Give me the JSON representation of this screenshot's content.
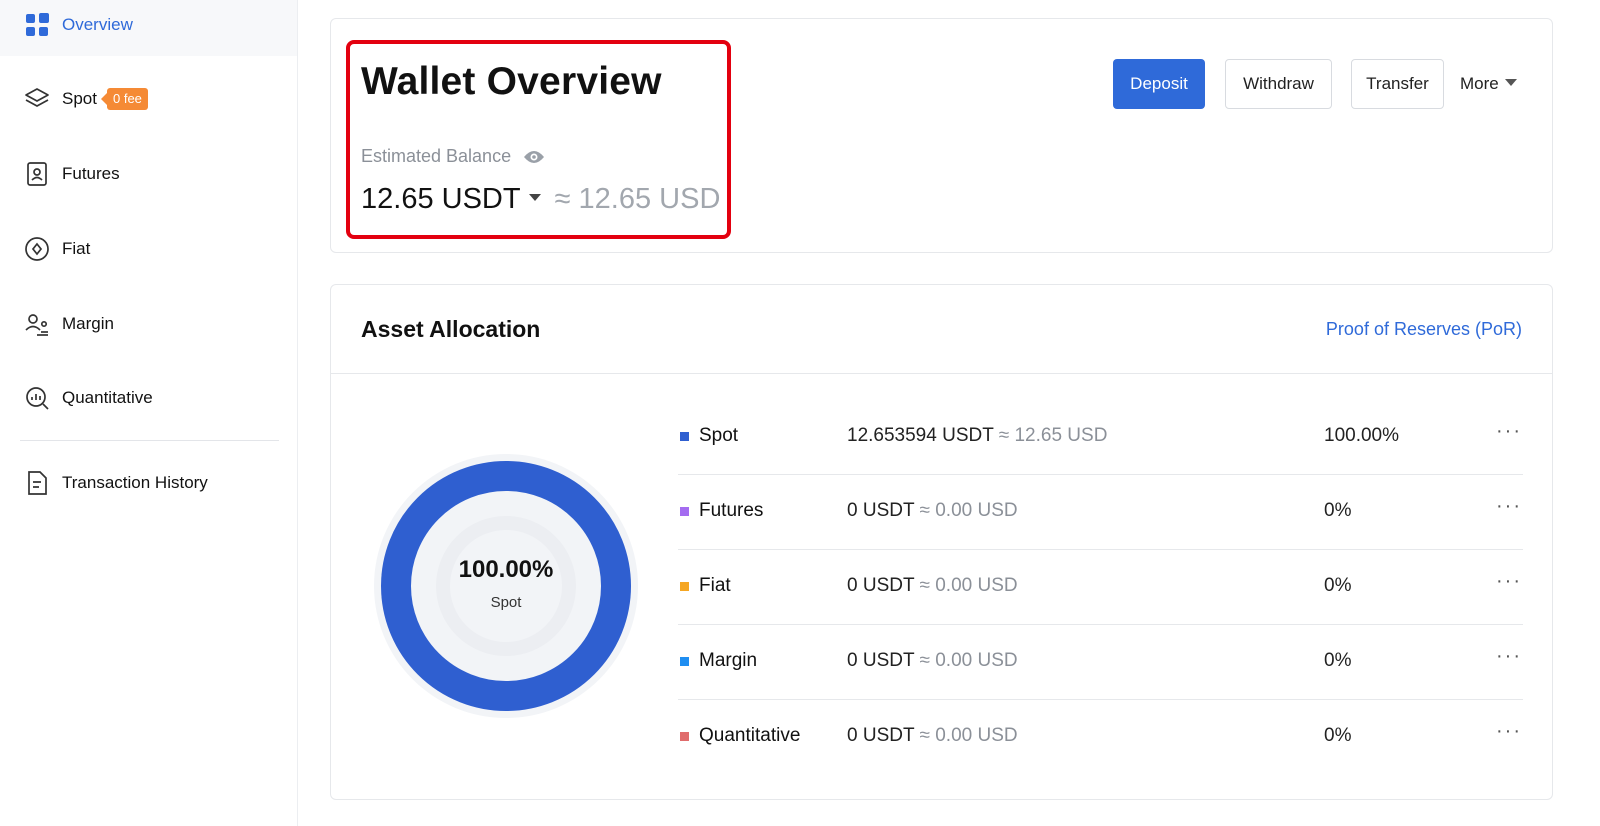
{
  "sidebar": {
    "items": [
      {
        "label": "Overview",
        "icon": "overview-grid-icon"
      },
      {
        "label": "Spot",
        "icon": "layers-icon",
        "badge": "0 fee"
      },
      {
        "label": "Futures",
        "icon": "futures-document-icon"
      },
      {
        "label": "Fiat",
        "icon": "fiat-coin-icon"
      },
      {
        "label": "Margin",
        "icon": "margin-users-icon"
      },
      {
        "label": "Quantitative",
        "icon": "quantitative-search-icon"
      },
      {
        "label": "Transaction History",
        "icon": "history-document-icon"
      }
    ]
  },
  "header": {
    "title": "Wallet Overview",
    "estimated_label": "Estimated Balance",
    "balance": "12.65 USDT",
    "balance_approx": "≈ 12.65 USD",
    "buttons": {
      "deposit": "Deposit",
      "withdraw": "Withdraw",
      "transfer": "Transfer",
      "more": "More"
    }
  },
  "allocation": {
    "title": "Asset Allocation",
    "por_link": "Proof of Reserves (PoR)",
    "donut": {
      "percent": "100.00%",
      "label": "Spot",
      "fill_fraction": 1.0
    },
    "rows": [
      {
        "name": "Spot",
        "amount": "12.653594 USDT",
        "approx": "≈ 12.65 USD",
        "percent": "100.00%",
        "color": "#2f5fd0"
      },
      {
        "name": "Futures",
        "amount": "0 USDT",
        "approx": "≈ 0.00 USD",
        "percent": "0%",
        "color": "#a46cf0"
      },
      {
        "name": "Fiat",
        "amount": "0 USDT",
        "approx": "≈ 0.00 USD",
        "percent": "0%",
        "color": "#f5a623"
      },
      {
        "name": "Margin",
        "amount": "0 USDT",
        "approx": "≈ 0.00 USD",
        "percent": "0%",
        "color": "#1f8ef1"
      },
      {
        "name": "Quantitative",
        "amount": "0 USDT",
        "approx": "≈ 0.00 USD",
        "percent": "0%",
        "color": "#e06c6c"
      }
    ]
  },
  "colors": {
    "accent": "#2f6ad9",
    "highlight": "#e3000f",
    "badge": "#f58a35"
  }
}
